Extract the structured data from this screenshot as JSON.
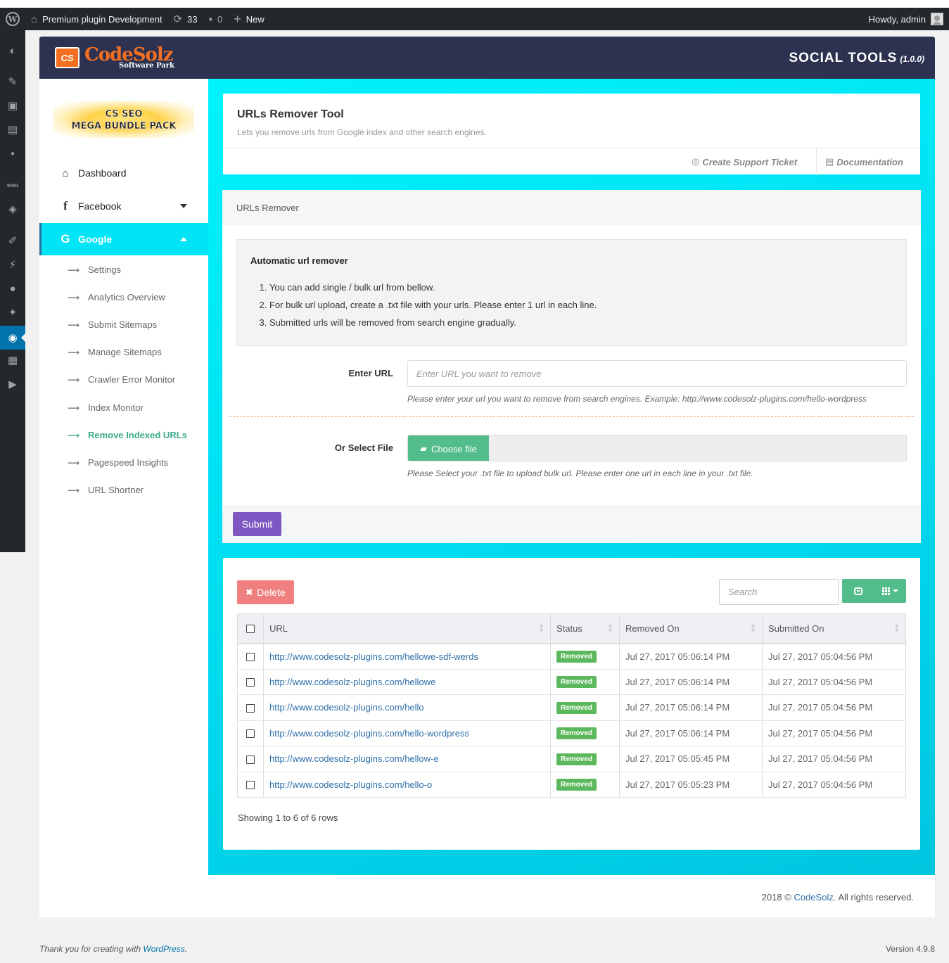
{
  "admin_bar": {
    "site_name": "Premium plugin Development",
    "updates_count": "33",
    "comments_count": "0",
    "new_label": "New",
    "greeting": "Howdy, admin"
  },
  "brand": {
    "logo_badge": "CS",
    "logo_name": "CodeSolz",
    "logo_sub": "Software Park",
    "app_title": "SOCIAL TOOLS",
    "app_version": "(1.0.0)"
  },
  "sidebar": {
    "bundle_line1": "CS SEO",
    "bundle_line2": "MEGA BUNDLE PACK",
    "items": [
      {
        "label": "Dashboard",
        "icon": "home-icon"
      },
      {
        "label": "Facebook",
        "icon": "facebook-icon"
      },
      {
        "label": "Google",
        "icon": "google-icon"
      }
    ],
    "submenu": [
      "Settings",
      "Analytics Overview",
      "Submit Sitemaps",
      "Manage Sitemaps",
      "Crawler Error Monitor",
      "Index Monitor",
      "Remove Indexed URLs",
      "Pagespeed Insights",
      "URL Shortner"
    ],
    "current_sub": "Remove Indexed URLs"
  },
  "tool_header": {
    "title": "URLs Remover Tool",
    "description": "Lets you remove urls from Google index and other search engines.",
    "support_link": "Create Support Ticket",
    "docs_link": "Documentation"
  },
  "remover": {
    "panel_title": "URLs Remover",
    "alert_title": "Automatic url remover",
    "steps": [
      "You can add single / bulk url from bellow.",
      "For bulk url upload, create a .txt file with your urls. Please enter 1 url in each line.",
      "Submitted urls will be removed from search engine gradually."
    ],
    "url_label": "Enter URL",
    "url_placeholder": "Enter URL you want to remove",
    "url_help": "Please enter your url you want to remove from search engines. Example: http://www.codesolz-plugins.com/hello-wordpress",
    "file_label": "Or Select File",
    "choose_file": "Choose file",
    "file_help": "Please Select your .txt file to upload bulk url. Please enter one url in each line in your .txt file.",
    "submit_label": "Submit"
  },
  "table": {
    "delete_label": "Delete",
    "search_placeholder": "Search",
    "headers": [
      "URL",
      "Status",
      "Removed On",
      "Submitted On"
    ],
    "rows": [
      {
        "url": "http://www.codesolz-plugins.com/hellowe-sdf-werds",
        "status": "Removed",
        "removed_on": "Jul 27, 2017 05:06:14 PM",
        "submitted_on": "Jul 27, 2017 05:04:56 PM"
      },
      {
        "url": "http://www.codesolz-plugins.com/hellowe",
        "status": "Removed",
        "removed_on": "Jul 27, 2017 05:06:14 PM",
        "submitted_on": "Jul 27, 2017 05:04:56 PM"
      },
      {
        "url": "http://www.codesolz-plugins.com/hello",
        "status": "Removed",
        "removed_on": "Jul 27, 2017 05:06:14 PM",
        "submitted_on": "Jul 27, 2017 05:04:56 PM"
      },
      {
        "url": "http://www.codesolz-plugins.com/hello-wordpress",
        "status": "Removed",
        "removed_on": "Jul 27, 2017 05:06:14 PM",
        "submitted_on": "Jul 27, 2017 05:04:56 PM"
      },
      {
        "url": "http://www.codesolz-plugins.com/hellow-e",
        "status": "Removed",
        "removed_on": "Jul 27, 2017 05:05:45 PM",
        "submitted_on": "Jul 27, 2017 05:04:56 PM"
      },
      {
        "url": "http://www.codesolz-plugins.com/hello-o",
        "status": "Removed",
        "removed_on": "Jul 27, 2017 05:05:23 PM",
        "submitted_on": "Jul 27, 2017 05:04:56 PM"
      }
    ],
    "showing": "Showing 1 to 6 of 6 rows"
  },
  "copyright": {
    "prefix": "2018 ©",
    "brand": "CodeSolz",
    "suffix": ". All rights reserved."
  },
  "wp_footer": {
    "thanks_prefix": "Thank you for creating with",
    "wordpress": "WordPress",
    "thanks_suffix": ".",
    "version": "Version 4.9.8"
  },
  "colors": {
    "admin_bar": "#23282d",
    "brand_header": "#2c3250",
    "accent_cyan": "#00e5f5",
    "success_green": "#52bc8b",
    "submit_purple": "#7e57c2",
    "delete_red": "#f08080",
    "logo_orange": "#f36f21"
  },
  "admin_menu_icons": [
    "dashboard-icon",
    "pin-icon",
    "media-icon",
    "pages-icon",
    "comments-icon",
    "woo-icon",
    "products-icon",
    "appearance-icon",
    "plugins-icon",
    "users-icon",
    "tools-icon",
    "social-tools-icon",
    "settings-icon",
    "play-icon"
  ]
}
